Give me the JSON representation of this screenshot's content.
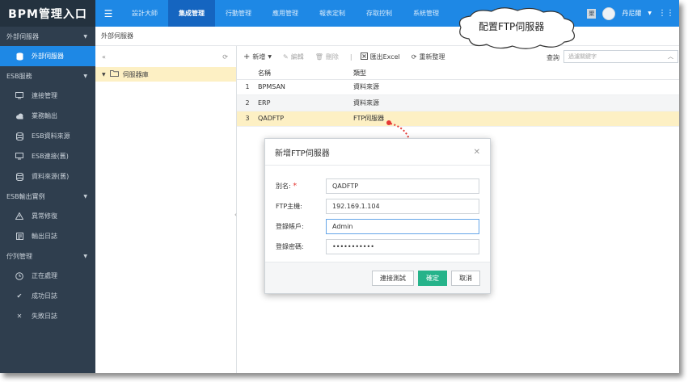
{
  "brand": "BPM管理入口",
  "topnav": {
    "tabs": [
      {
        "label": "設計大師"
      },
      {
        "label": "集成管理",
        "active": true
      },
      {
        "label": "行動管理"
      },
      {
        "label": "應用管理"
      },
      {
        "label": "報表定制"
      },
      {
        "label": "存取控制"
      },
      {
        "label": "系統管理"
      }
    ],
    "user_name": "丹尼爾",
    "notice_badge": "聚"
  },
  "sidebar": {
    "groups": [
      {
        "label": "外部伺服器",
        "items": [
          {
            "label": "外部伺服器",
            "icon": "database-icon",
            "active": true
          }
        ]
      },
      {
        "label": "ESB服務",
        "items": [
          {
            "label": "連接管理",
            "icon": "monitor-icon"
          },
          {
            "label": "業務輸出",
            "icon": "cloud-icon"
          },
          {
            "label": "ESB資料來源",
            "icon": "database-icon"
          },
          {
            "label": "ESB連接(舊)",
            "icon": "monitor-icon"
          },
          {
            "label": "資料來源(舊)",
            "icon": "database-icon"
          }
        ]
      },
      {
        "label": "ESB輸出實例",
        "items": [
          {
            "label": "異常修復",
            "icon": "warning-icon"
          },
          {
            "label": "輸出日誌",
            "icon": "log-icon"
          }
        ]
      },
      {
        "label": "佇列管理",
        "items": [
          {
            "label": "正在處理",
            "icon": "clock-icon"
          },
          {
            "label": "成功日誌",
            "icon": "check-icon"
          },
          {
            "label": "失敗日誌",
            "icon": "cross-icon"
          }
        ]
      }
    ]
  },
  "breadcrumb": "外部伺服器",
  "tree": {
    "root_label": "伺服器庫"
  },
  "toolbar": {
    "add": "新增",
    "edit": "編輯",
    "delete": "刪除",
    "export": "匯出Excel",
    "reset": "重新整理",
    "search_label": "查詢",
    "search_placeholder": "過濾關鍵字"
  },
  "table": {
    "columns": [
      "名稱",
      "類型"
    ],
    "rows": [
      {
        "num": "1",
        "name": "BPMSAN",
        "type": "資料來源"
      },
      {
        "num": "2",
        "name": "ERP",
        "type": "資料來源"
      },
      {
        "num": "3",
        "name": "QADFTP",
        "type": "FTP伺服器"
      }
    ]
  },
  "dialog": {
    "title": "新增FTP伺服器",
    "fields": [
      {
        "label": "別名:",
        "value": "QADFTP"
      },
      {
        "label": "FTP主機:",
        "value": "192.169.1.104"
      },
      {
        "label": "登錄帳戶:",
        "value": "Admin"
      },
      {
        "label": "登錄密碼:",
        "value": "•••••••••••"
      }
    ],
    "required_mark": "*",
    "buttons": {
      "test": "連接測試",
      "ok": "確定",
      "cancel": "取消"
    }
  },
  "callout": "配置FTP伺服器",
  "colors": {
    "accent": "#1e88e5",
    "sidebar": "#2f3e4e",
    "selected_row": "#fdf0c4",
    "ok_button": "#26b38a",
    "arrow": "#e53935"
  }
}
